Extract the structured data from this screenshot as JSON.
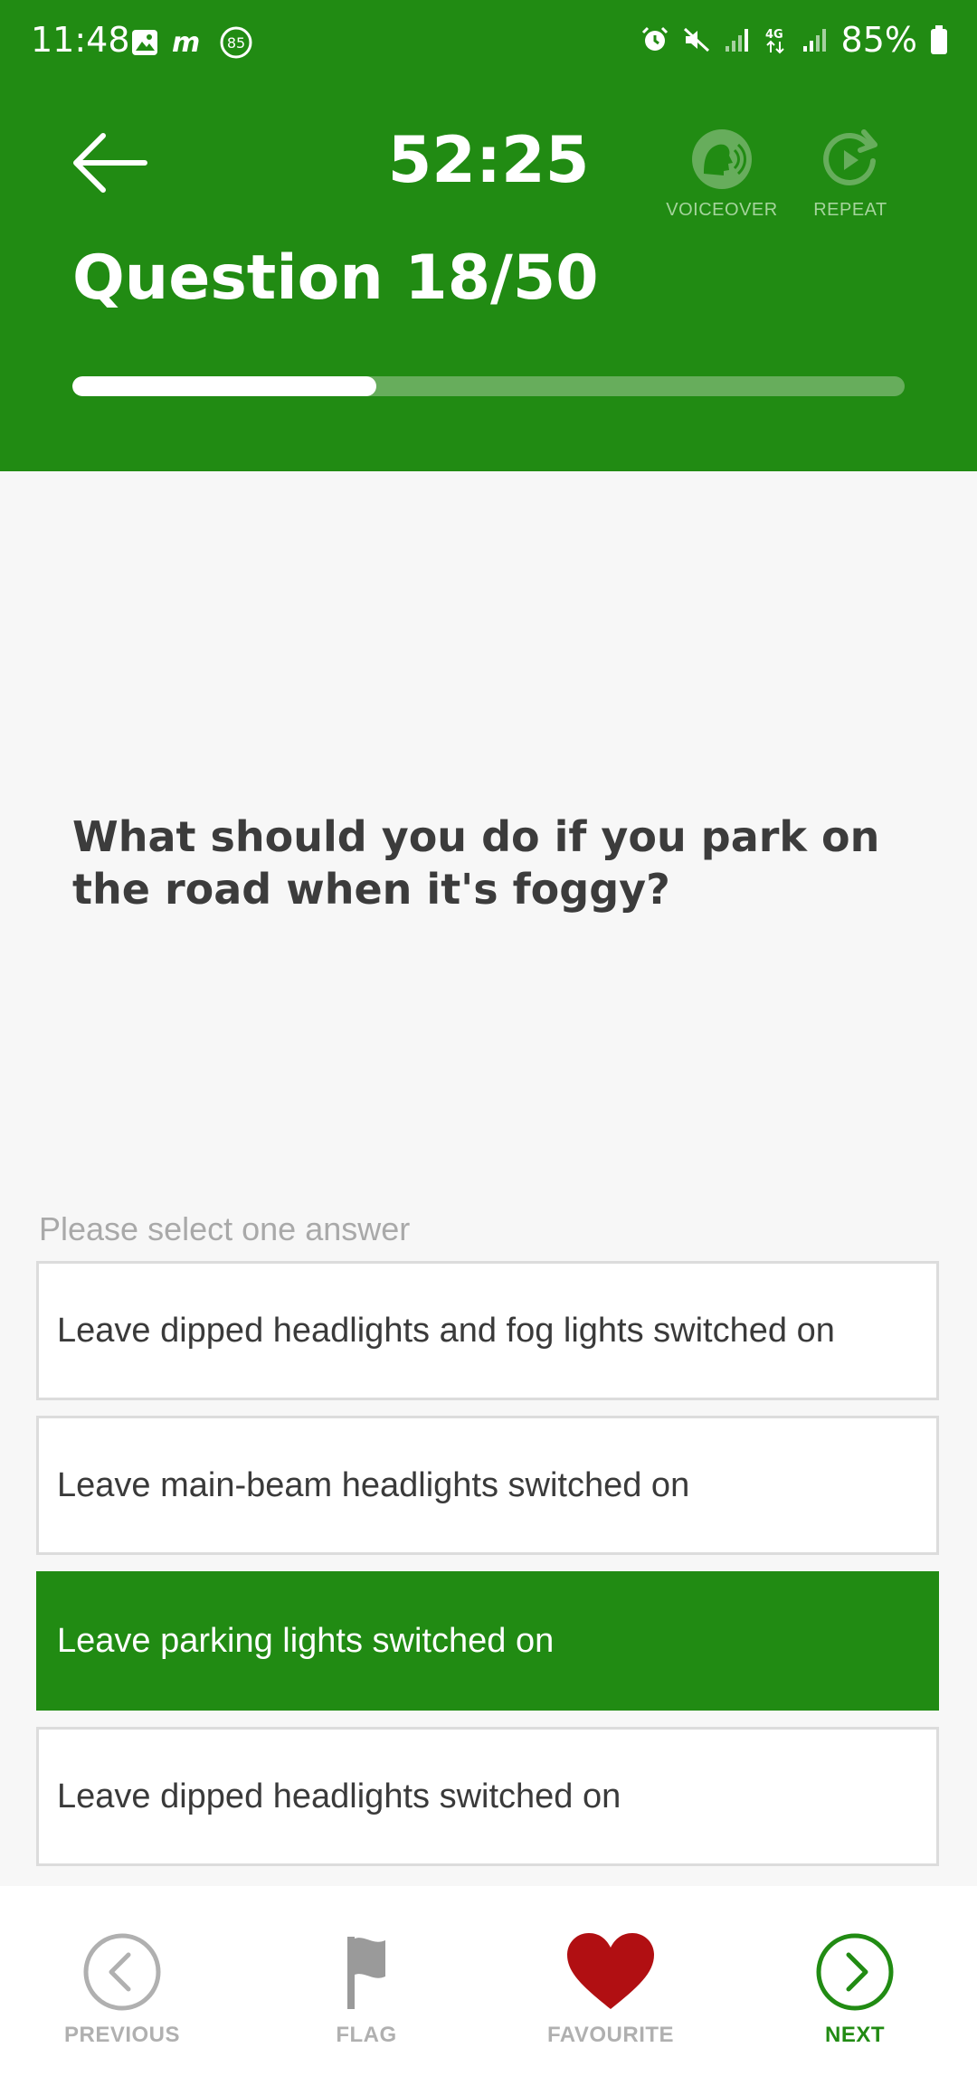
{
  "status_bar": {
    "time": "11:48",
    "notification_count": "85",
    "battery": "85%"
  },
  "header": {
    "timer": "52:25",
    "voiceover_label": "VOICEOVER",
    "repeat_label": "REPEAT",
    "question_count": "Question 18/50",
    "progress_fraction": 0.365
  },
  "question": {
    "text": "What should you do if you park on the road when it's foggy?",
    "hint": "Please select one answer"
  },
  "answers": [
    {
      "text": "Leave dipped headlights and fog lights switched on",
      "selected": false
    },
    {
      "text": "Leave main-beam headlights switched on",
      "selected": false
    },
    {
      "text": "Leave parking lights switched on",
      "selected": true
    },
    {
      "text": "Leave dipped headlights switched on",
      "selected": false
    }
  ],
  "bottom_nav": {
    "previous": "PREVIOUS",
    "flag": "FLAG",
    "favourite": "FAVOURITE",
    "next": "NEXT"
  },
  "colors": {
    "brand_green": "#218b13",
    "favourite_red": "#b10f12"
  }
}
